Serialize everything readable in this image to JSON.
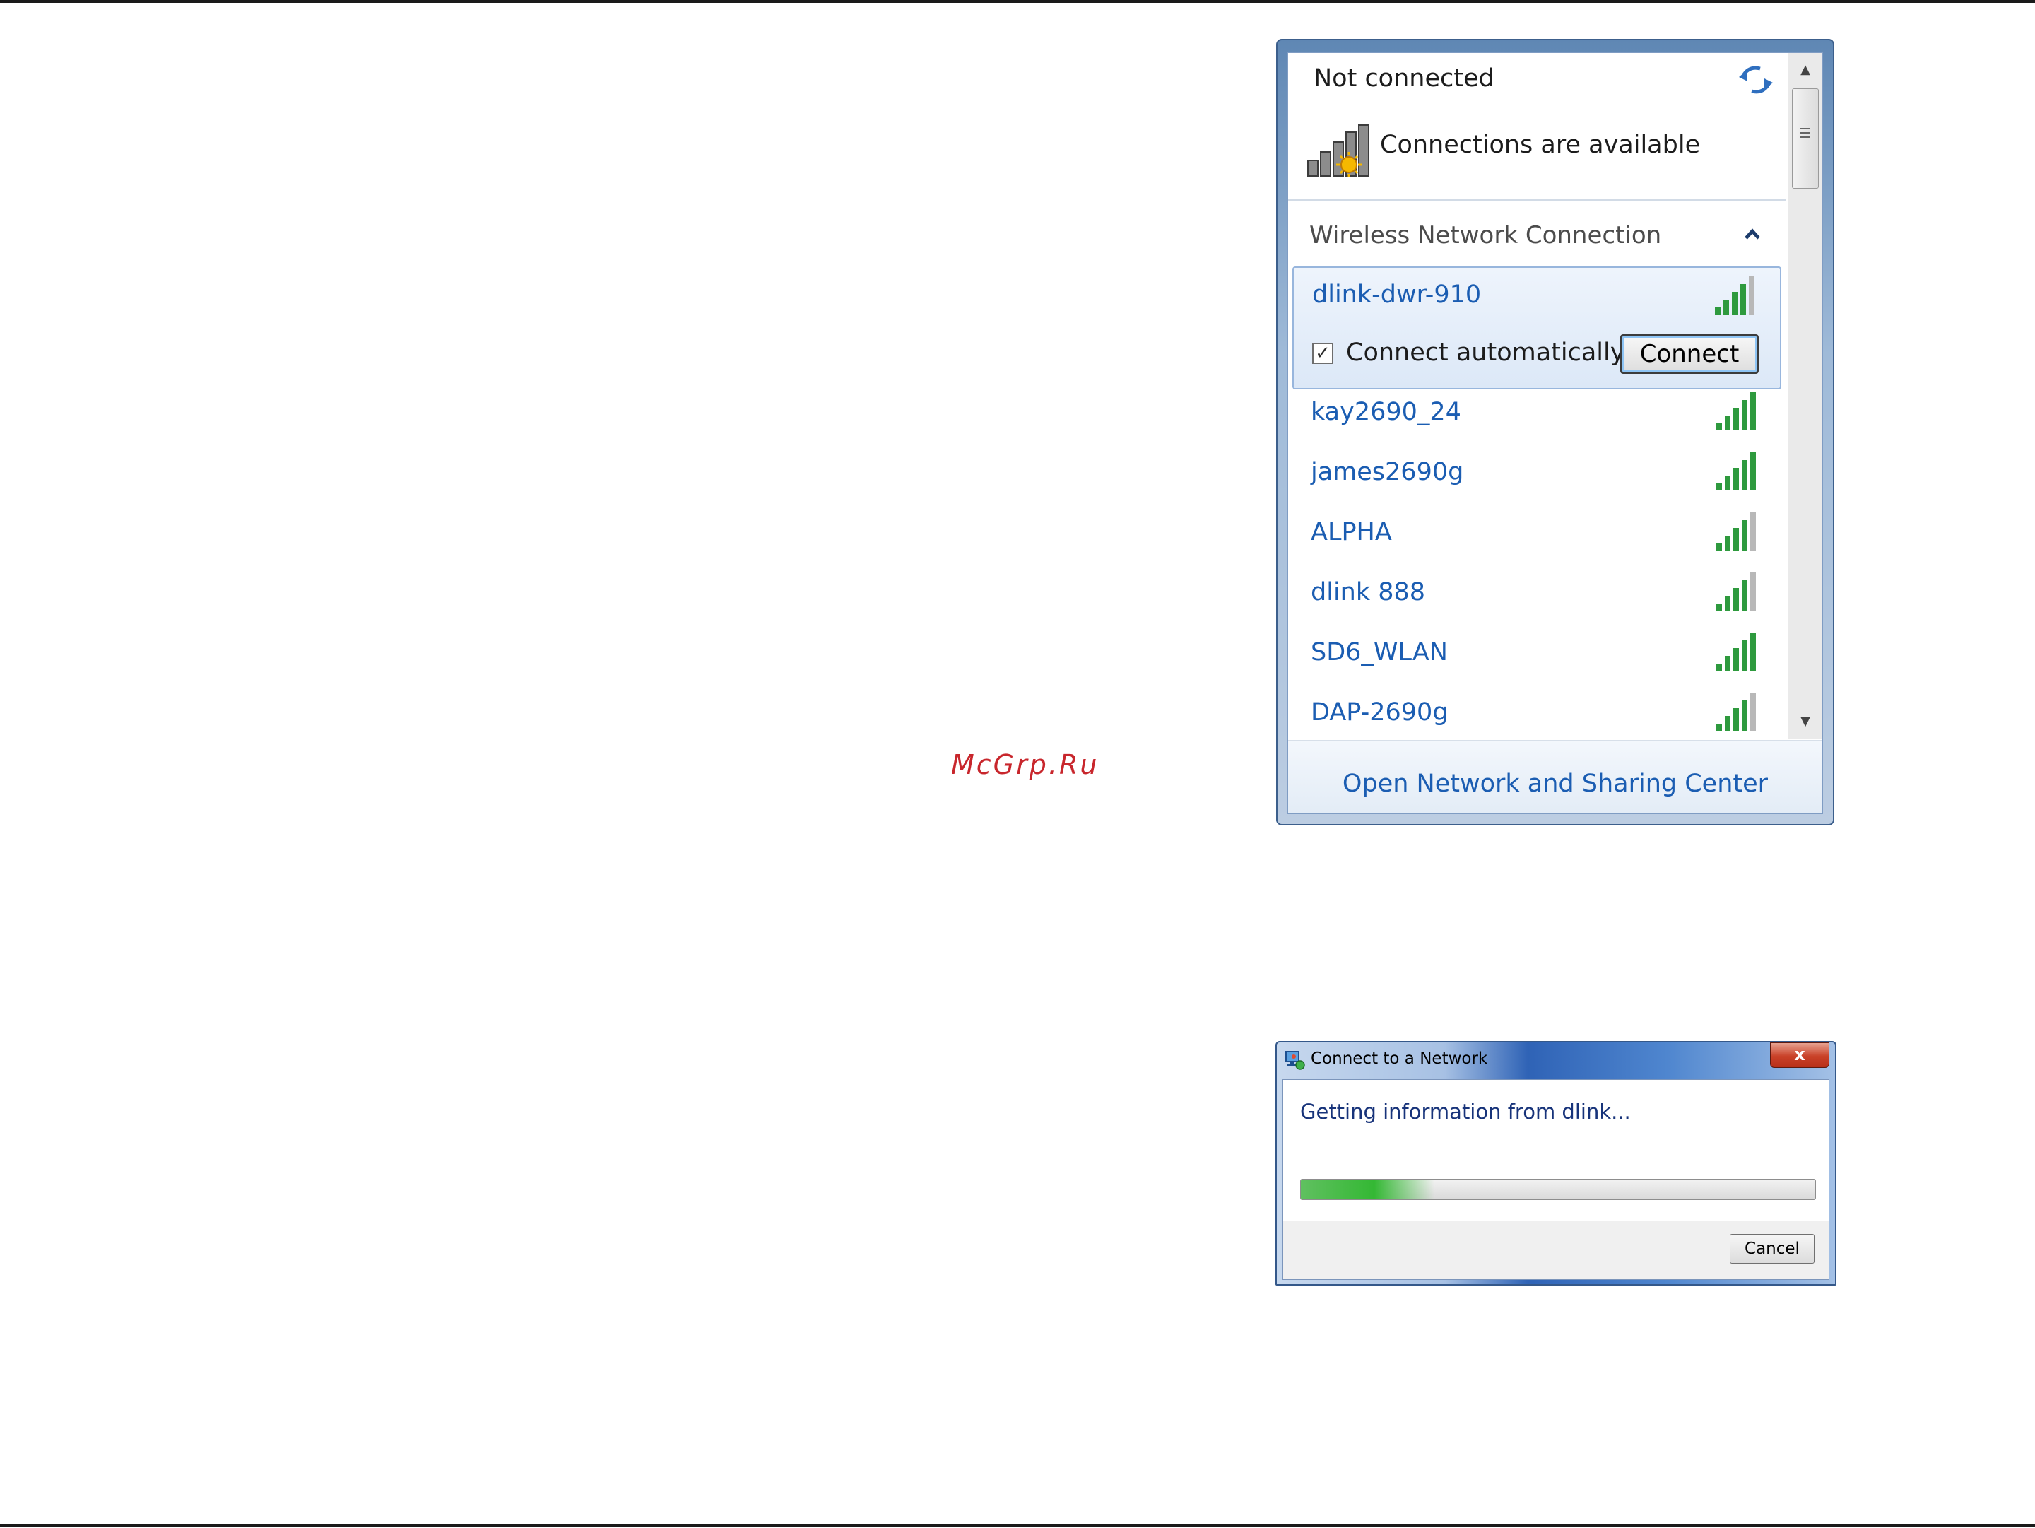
{
  "watermark": "McGrp.Ru",
  "flyout": {
    "status": "Not connected",
    "availability": "Connections are available",
    "section_label": "Wireless Network Connection",
    "selected_network": {
      "name": "dlink-dwr-910",
      "signal_bars": 4,
      "connect_automatically_label": "Connect automatically",
      "connect_automatically_checked": true,
      "checkbox_mark": "✓",
      "connect_button": "Connect"
    },
    "networks": [
      {
        "name": "kay2690_24",
        "signal_bars": 5
      },
      {
        "name": "james2690g",
        "signal_bars": 5
      },
      {
        "name": "ALPHA",
        "signal_bars": 4
      },
      {
        "name": "dlink 888",
        "signal_bars": 4
      },
      {
        "name": "SD6_WLAN",
        "signal_bars": 5
      },
      {
        "name": "DAP-2690g",
        "signal_bars": 4
      }
    ],
    "footer_link": "Open Network and Sharing Center",
    "scroll_up_glyph": "▲",
    "scroll_down_glyph": "▼"
  },
  "dialog": {
    "title": "Connect to a Network",
    "close_glyph": "x",
    "message": "Getting information from dlink...",
    "progress_fraction": 0.26,
    "cancel_button": "Cancel"
  },
  "colors": {
    "link_blue": "#1b5db2",
    "signal_green": "#2e9a3e",
    "signal_gray": "#b8b8b8"
  },
  "icons": {
    "refresh": "refresh-icon",
    "connections": "connections-available-icon",
    "collapse": "chevron-up-icon",
    "signal": "signal-strength-icon",
    "dialog_app": "network-icon",
    "close": "close-icon"
  }
}
